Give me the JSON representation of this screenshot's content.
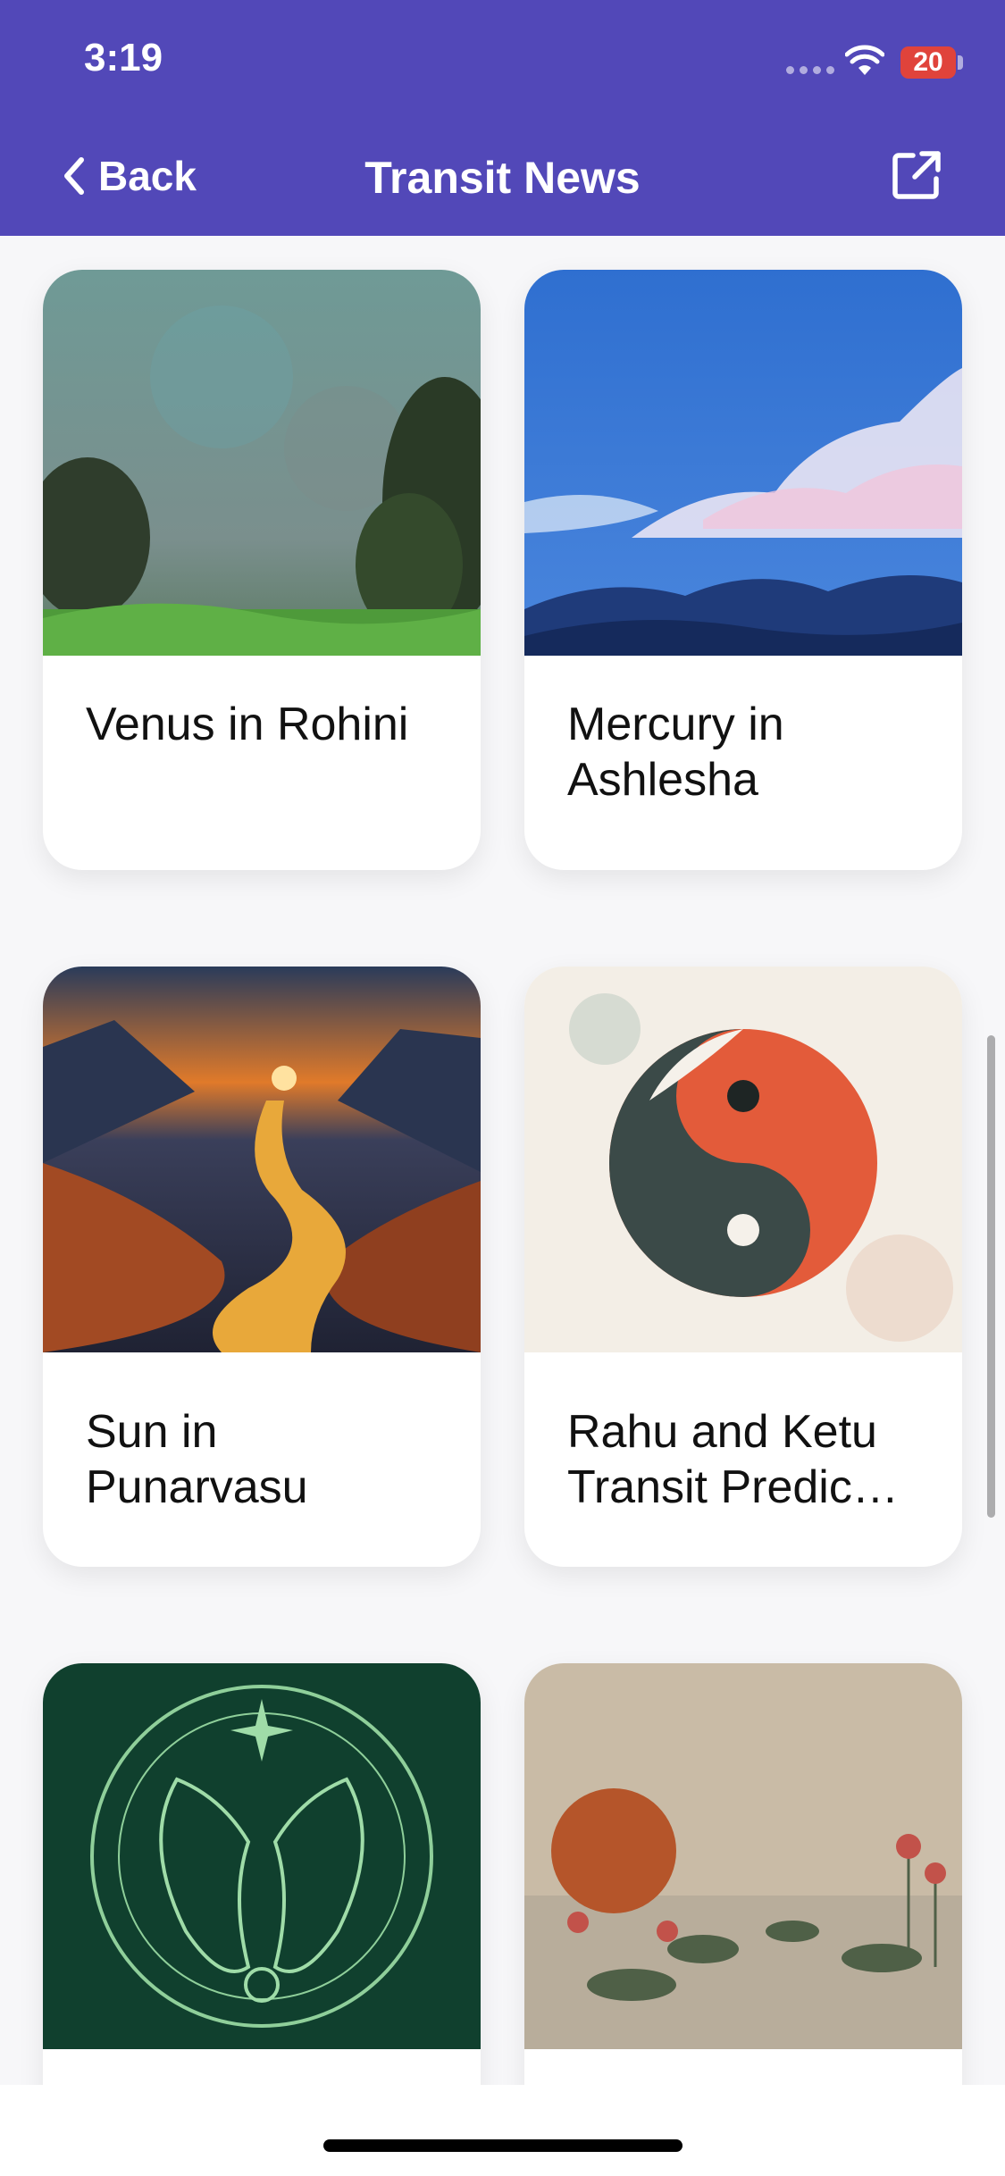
{
  "status_bar": {
    "time": "3:19",
    "battery": "20"
  },
  "nav": {
    "back_label": "Back",
    "title": "Transit News"
  },
  "icons": {
    "back": "chevron-left-icon",
    "share": "share-external-icon",
    "wifi": "wifi-icon"
  },
  "colors": {
    "header": "#5248b8",
    "battery_low": "#e0433b"
  },
  "cards": [
    {
      "title": "Venus in Rohini"
    },
    {
      "title": "Mercury in Ashlesha"
    },
    {
      "title": "Sun in Punarvasu"
    },
    {
      "title": "Rahu and Ketu Transit Predic…"
    },
    {
      "title": ""
    },
    {
      "title": ""
    }
  ]
}
